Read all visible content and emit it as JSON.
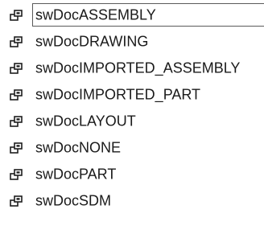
{
  "list": {
    "items": [
      {
        "label": "swDocASSEMBLY",
        "icon": "enum-member-icon",
        "selected": true
      },
      {
        "label": "swDocDRAWING",
        "icon": "enum-member-icon",
        "selected": false
      },
      {
        "label": "swDocIMPORTED_ASSEMBLY",
        "icon": "enum-member-icon",
        "selected": false
      },
      {
        "label": "swDocIMPORTED_PART",
        "icon": "enum-member-icon",
        "selected": false
      },
      {
        "label": "swDocLAYOUT",
        "icon": "enum-member-icon",
        "selected": false
      },
      {
        "label": "swDocNONE",
        "icon": "enum-member-icon",
        "selected": false
      },
      {
        "label": "swDocPART",
        "icon": "enum-member-icon",
        "selected": false
      },
      {
        "label": "swDocSDM",
        "icon": "enum-member-icon",
        "selected": false
      }
    ]
  },
  "colors": {
    "icon": "#1e1e1e",
    "text": "#1a1a1a",
    "selection_border": "#5a5a5a"
  }
}
